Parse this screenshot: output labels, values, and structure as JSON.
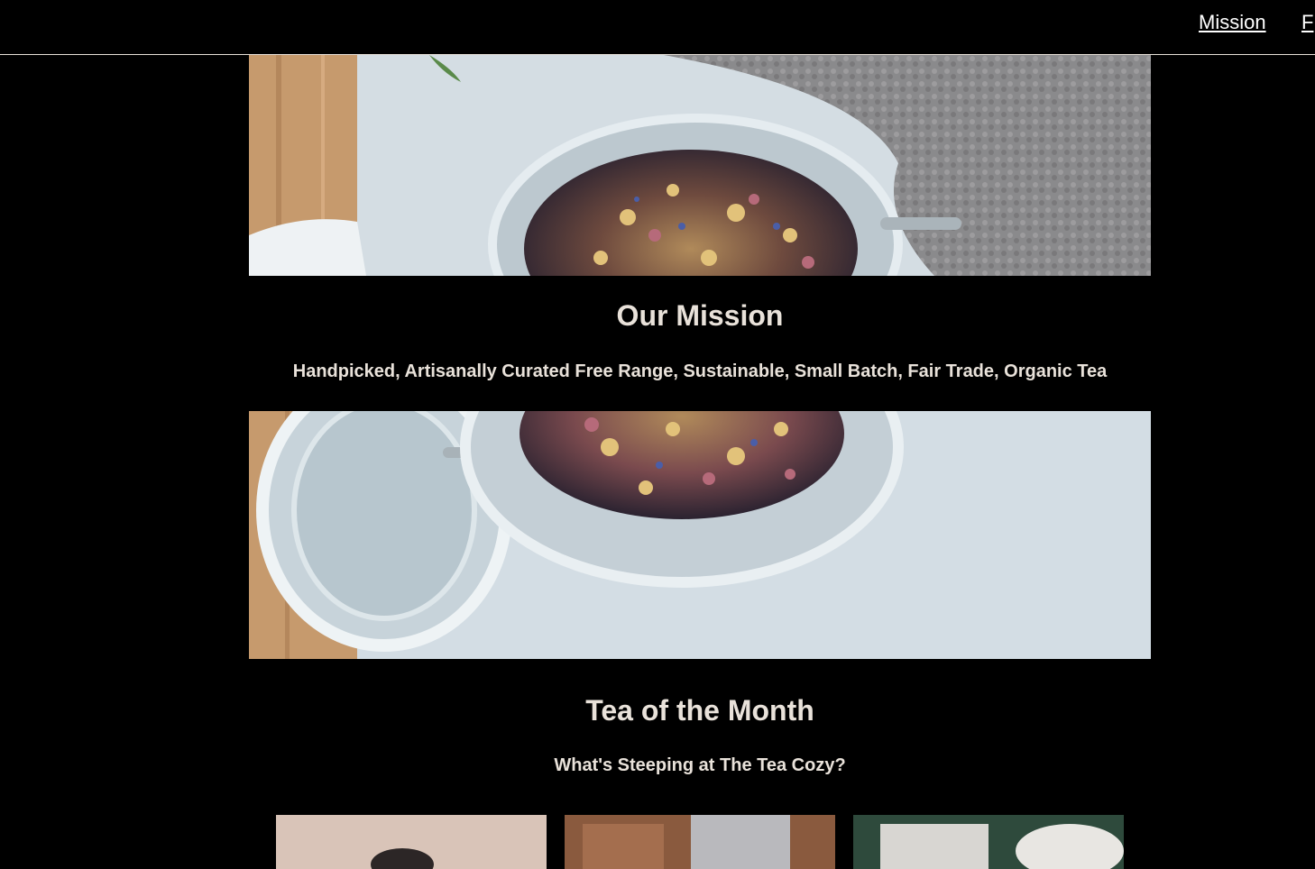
{
  "nav": {
    "mission_label": "Mission",
    "featured_label": "F"
  },
  "mission": {
    "title": "Our Mission",
    "subtitle": "Handpicked, Artisanally Curated Free Range, Sustainable, Small Batch, Fair Trade, Organic Tea"
  },
  "tea_of_month": {
    "title": "Tea of the Month",
    "subtitle": "What's Steeping at The Tea Cozy?"
  },
  "colors": {
    "background": "#000000",
    "text": "#e9e2da",
    "link": "#ffffff"
  }
}
